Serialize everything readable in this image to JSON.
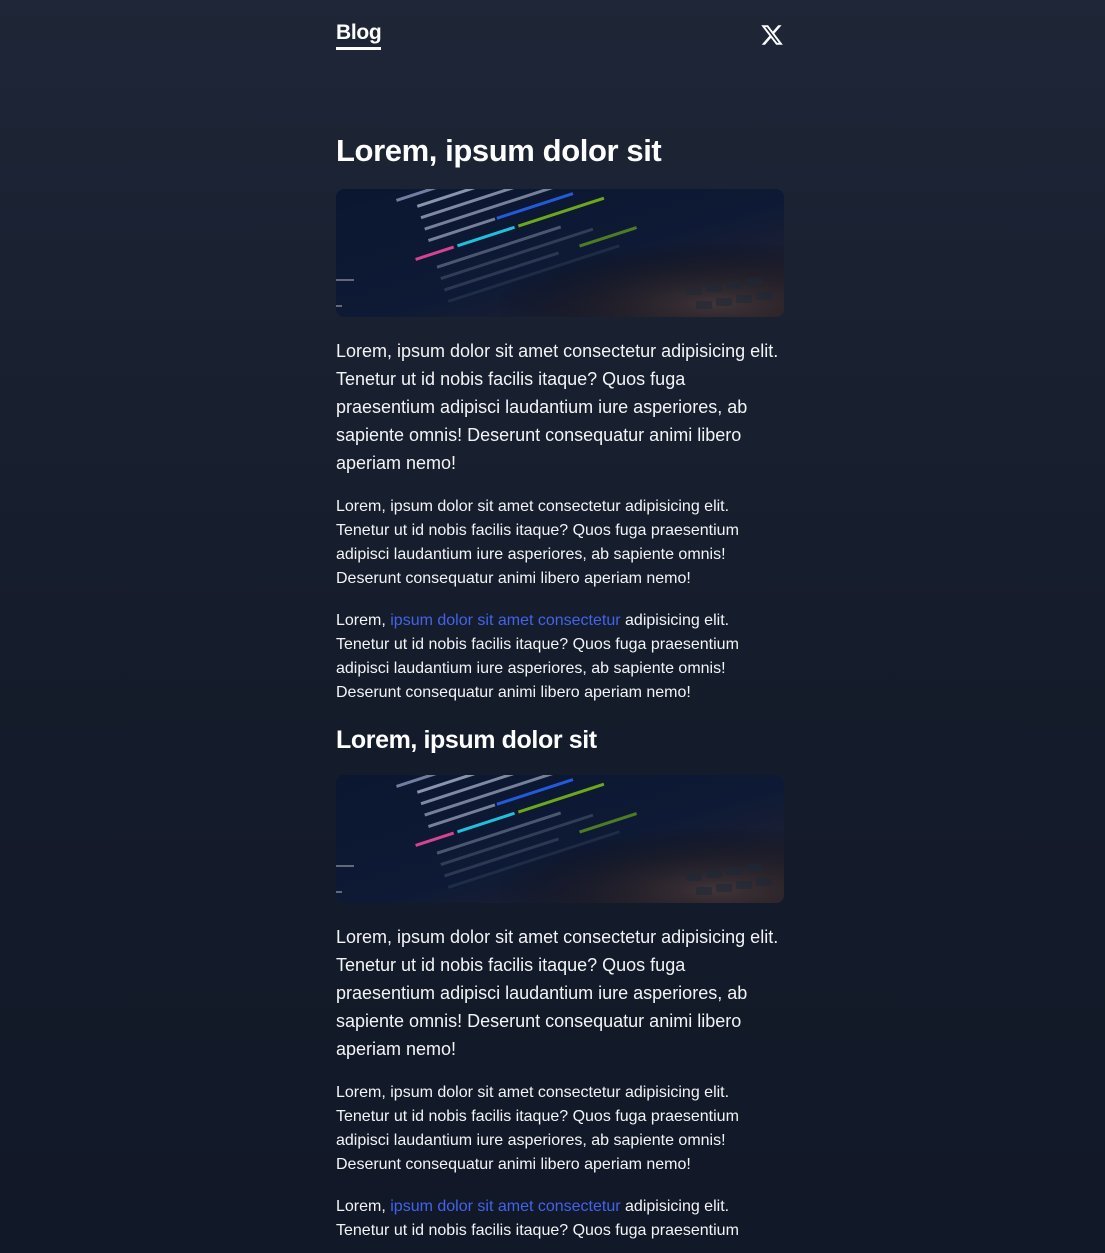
{
  "header": {
    "blog_link": "Blog",
    "social_icon": "x-logo-icon"
  },
  "posts": [
    {
      "title": "Lorem, ipsum dolor sit",
      "image_icon": "code-screenshot-image",
      "lead": "Lorem, ipsum dolor sit amet consectetur adipisicing elit. Tenetur ut id nobis facilis itaque? Quos fuga praesentium adipisci laudantium iure asperiores, ab sapiente omnis! Deserunt consequatur animi libero aperiam nemo!",
      "paragraph": "Lorem, ipsum dolor sit amet consectetur adipisicing elit. Tenetur ut id nobis facilis itaque? Quos fuga praesentium adipisci laudantium iure asperiores, ab sapiente omnis! Deserunt consequatur animi libero aperiam nemo!",
      "link_paragraph": {
        "before": "Lorem, ",
        "link": "ipsum dolor sit amet consectetur",
        "after": " adipisicing elit. Tenetur ut id nobis facilis itaque? Quos fuga praesentium adipisci laudantium iure asperiores, ab sapiente omnis! Deserunt consequatur animi libero aperiam nemo!"
      }
    },
    {
      "title": "Lorem, ipsum dolor sit",
      "image_icon": "code-screenshot-image",
      "lead": "Lorem, ipsum dolor sit amet consectetur adipisicing elit. Tenetur ut id nobis facilis itaque? Quos fuga praesentium adipisci laudantium iure asperiores, ab sapiente omnis! Deserunt consequatur animi libero aperiam nemo!",
      "paragraph": "Lorem, ipsum dolor sit amet consectetur adipisicing elit. Tenetur ut id nobis facilis itaque? Quos fuga praesentium adipisci laudantium iure asperiores, ab sapiente omnis! Deserunt consequatur animi libero aperiam nemo!",
      "link_paragraph": {
        "before": "Lorem, ",
        "link": "ipsum dolor sit amet consectetur",
        "after": " adipisicing elit. Tenetur ut id nobis facilis itaque? Quos fuga praesentium"
      }
    }
  ],
  "colors": {
    "background_top": "#1e2637",
    "background_bottom": "#111827",
    "text": "#f3f4f6",
    "link": "#4263eb"
  }
}
